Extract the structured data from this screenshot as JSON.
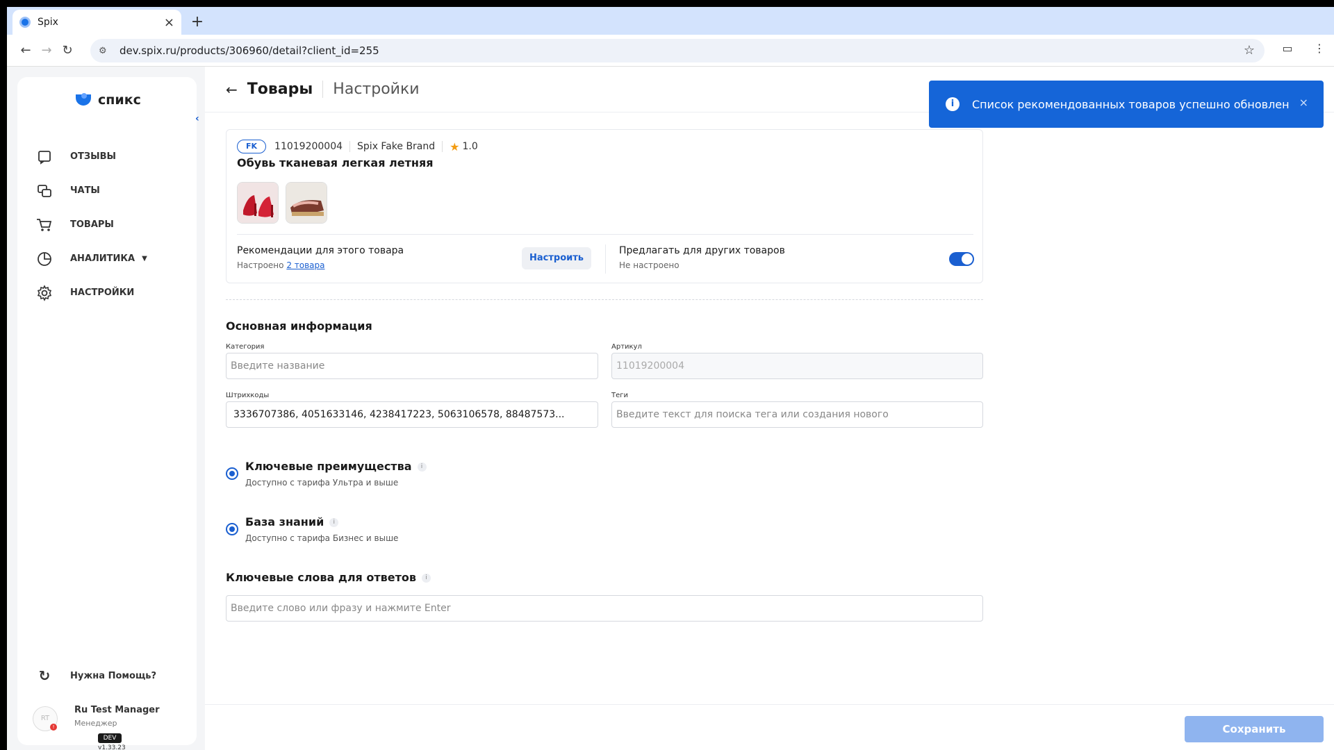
{
  "browser": {
    "tab_title": "Spix",
    "tab_close": "×",
    "new_tab": "+",
    "url": "dev.spix.ru/products/306960/detail?client_id=255"
  },
  "sidebar": {
    "logo_text": "спикс",
    "nav": [
      {
        "label": "ОТЗЫВЫ",
        "icon": "reviews-icon"
      },
      {
        "label": "ЧАТЫ",
        "icon": "chats-icon"
      },
      {
        "label": "ТОВАРЫ",
        "icon": "cart-icon"
      },
      {
        "label": "АНАЛИТИКА",
        "icon": "analytics-icon"
      },
      {
        "label": "НАСТРОЙКИ",
        "icon": "gear-icon"
      }
    ],
    "help": "Нужна Помощь?",
    "user_name": "Ru Test Manager",
    "user_role": "Менеджер",
    "user_initials": "RT",
    "env": "DEV",
    "version": "v1.33.23"
  },
  "header": {
    "title": "Товары",
    "subtitle": "Настройки"
  },
  "product": {
    "badge": "FK",
    "sku": "11019200004",
    "brand": "Spix Fake Brand",
    "rating": "1.0",
    "name": "Обувь тканевая легкая летняя",
    "rec_title": "Рекомендации для этого товара",
    "rec_status": "Настроено",
    "rec_link": "2 товара",
    "configure_label": "Настроить",
    "offer_title": "Предлагать для других товаров",
    "offer_status": "Не настроено",
    "offer_enabled": true
  },
  "basic_info": {
    "title": "Основная информация",
    "category_label": "Категория",
    "category_placeholder": "Введите название",
    "article_label": "Артикул",
    "article_value": "11019200004",
    "barcodes_label": "Штрихкоды",
    "barcodes_value": "3336707386, 4051633146, 4238417223, 5063106578, 88487573...",
    "tags_label": "Теги",
    "tags_placeholder": "Введите текст для поиска тега или создания нового"
  },
  "options": [
    {
      "title": "Ключевые преимущества",
      "sub": "Доступно с тарифа Ультра и выше"
    },
    {
      "title": "База знаний",
      "sub": "Доступно с тарифа Бизнес и выше"
    }
  ],
  "keywords": {
    "title": "Ключевые слова для ответов",
    "placeholder": "Введите слово или фразу и нажмите Enter"
  },
  "footer": {
    "save_label": "Сохранить"
  },
  "toast": {
    "message": "Список рекомендованных товаров успешно обновлен",
    "close": "×"
  },
  "colors": {
    "accent": "#1a5fd0",
    "toast_bg": "#1565d8",
    "save_disabled": "#8fb4ef"
  }
}
